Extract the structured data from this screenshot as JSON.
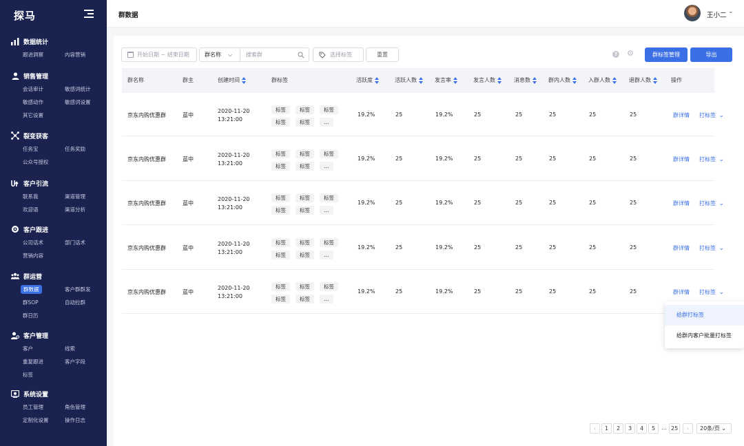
{
  "sidebar": {
    "brand": "探马",
    "sections": [
      {
        "title": "数据统计",
        "icon": "bar-chart-icon",
        "items": [
          "跟进洞察",
          "内容营销"
        ]
      },
      {
        "title": "销售管理",
        "icon": "person-icon",
        "items": [
          "会话审计",
          "敏感词统计",
          "敏感动作",
          "敏感词设置",
          "其它设置"
        ]
      },
      {
        "title": "裂变获客",
        "icon": "fission-icon",
        "items": [
          "任务宝",
          "任务奖励",
          "公众号授权"
        ]
      },
      {
        "title": "客户引流",
        "icon": "funnel-icon",
        "items": [
          "联系我",
          "渠道管理",
          "欢迎语",
          "渠道分析"
        ]
      },
      {
        "title": "客户跟进",
        "icon": "target-icon",
        "items": [
          "公司话术",
          "部门话术",
          "营销内容"
        ]
      },
      {
        "title": "群运营",
        "icon": "group-icon",
        "items": [
          "群数据",
          "客户群群发",
          "群SOP",
          "自动拉群",
          "群日历"
        ],
        "active": "群数据"
      },
      {
        "title": "客户管理",
        "icon": "user-manage-icon",
        "items": [
          "客户",
          "线索",
          "重复跟进",
          "客户字段",
          "标签"
        ]
      },
      {
        "title": "系统设置",
        "icon": "settings-icon",
        "items": [
          "员工管理",
          "角色管理",
          "定制化设置",
          "操作日志"
        ]
      }
    ]
  },
  "header": {
    "title": "群数据",
    "user_name": "王小二"
  },
  "filters": {
    "date_placeholder": "开始日期 ~ 结束日期",
    "search_type": "群名称",
    "search_placeholder": "搜索群",
    "tag_placeholder": "选择标签",
    "reset_label": "重置",
    "tag_manage_label": "群标签管理",
    "export_label": "导出"
  },
  "table": {
    "columns": [
      "群名称",
      "群主",
      "创建时间",
      "群标签",
      "活跃度",
      "活跃人数",
      "发言率",
      "发言人数",
      "消息数",
      "群内人数",
      "入群人数",
      "退群人数",
      "操作"
    ],
    "rows": [
      {
        "name": "京东内购优惠群",
        "owner": "蓝中",
        "date": "2020-11-20",
        "time": "13:21:00",
        "tags": [
          "标签",
          "标签",
          "标签",
          "标签",
          "标签",
          "…"
        ],
        "activity": "19.2%",
        "active_count": "25",
        "speak_rate": "19.2%",
        "speak_count": "25",
        "messages": "25",
        "members": "25",
        "joined": "25",
        "left": "25",
        "detail": "群详情",
        "tagging": "打标签"
      },
      {
        "name": "京东内购优惠群",
        "owner": "蓝中",
        "date": "2020-11-20",
        "time": "13:21:00",
        "tags": [
          "标签",
          "标签",
          "标签",
          "标签",
          "标签",
          "…"
        ],
        "activity": "19.2%",
        "active_count": "25",
        "speak_rate": "19.2%",
        "speak_count": "25",
        "messages": "25",
        "members": "25",
        "joined": "25",
        "left": "25",
        "detail": "群详情",
        "tagging": "打标签"
      },
      {
        "name": "京东内购优惠群",
        "owner": "蓝中",
        "date": "2020-11-20",
        "time": "13:21:00",
        "tags": [
          "标签",
          "标签",
          "标签",
          "标签",
          "标签",
          "…"
        ],
        "activity": "19.2%",
        "active_count": "25",
        "speak_rate": "19.2%",
        "speak_count": "25",
        "messages": "25",
        "members": "25",
        "joined": "25",
        "left": "25",
        "detail": "群详情",
        "tagging": "打标签"
      },
      {
        "name": "京东内购优惠群",
        "owner": "蓝中",
        "date": "2020-11-20",
        "time": "13:21:00",
        "tags": [
          "标签",
          "标签",
          "标签",
          "标签",
          "标签",
          "…"
        ],
        "activity": "19.2%",
        "active_count": "25",
        "speak_rate": "19.2%",
        "speak_count": "25",
        "messages": "25",
        "members": "25",
        "joined": "25",
        "left": "25",
        "detail": "群详情",
        "tagging": "打标签"
      },
      {
        "name": "京东内购优惠群",
        "owner": "蓝中",
        "date": "2020-11-20",
        "time": "13:21:00",
        "tags": [
          "标签",
          "标签",
          "标签",
          "标签",
          "标签",
          "…"
        ],
        "activity": "19.2%",
        "active_count": "25",
        "speak_rate": "19.2%",
        "speak_count": "25",
        "messages": "25",
        "members": "25",
        "joined": "25",
        "left": "25",
        "detail": "群详情",
        "tagging": "打标签"
      }
    ]
  },
  "dropdown": {
    "items": [
      "给群打标签",
      "给群内客户批量打标签"
    ]
  },
  "pagination": {
    "pages": [
      "1",
      "2",
      "3",
      "4",
      "5",
      "…",
      "25"
    ],
    "page_size": "20条/页"
  },
  "colors": {
    "sidebar_bg": "#1a2350",
    "primary": "#3a6fe6",
    "header_bg": "#f3f4f7"
  }
}
